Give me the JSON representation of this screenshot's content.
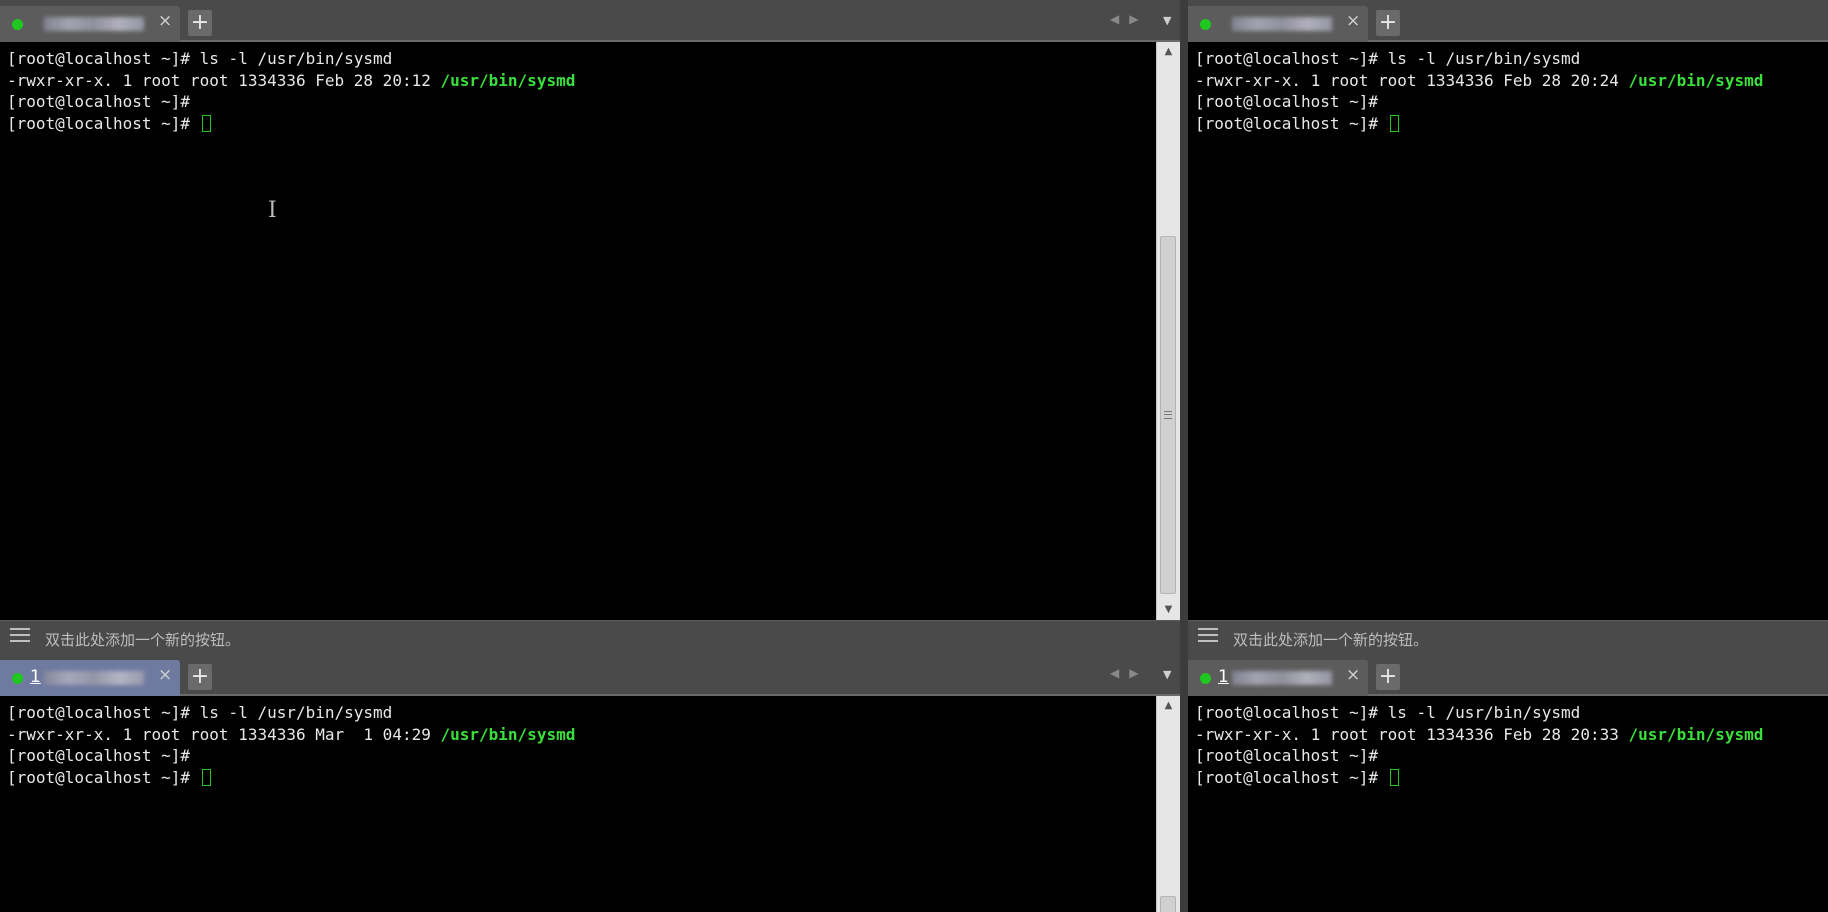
{
  "colors": {
    "terminal_bg": "#000000",
    "prompt_text": "#e8e8e8",
    "path_green": "#3ae03a",
    "status_dot": "#1ec81e",
    "active_tab": "#6e7aa0"
  },
  "quickbar_text": "双击此处添加一个新的按钮。",
  "icons": {
    "tab_close": "×",
    "add_tab": "+",
    "nav_prev": "◀",
    "nav_next": "▶",
    "tab_list": "▼",
    "scroll_up": "▲",
    "scroll_down": "▼",
    "quickbar_menu": "hamburger-icon"
  },
  "panes": [
    {
      "tab": {
        "number": "",
        "active": false
      },
      "lines": {
        "l1": "[root@localhost ~]# ls -l /usr/bin/sysmd",
        "l2_prefix": "-rwxr-xr-x. 1 root root 1334336 Feb 28 20:12 ",
        "l2_path": "/usr/bin/sysmd",
        "l3": "[root@localhost ~]#",
        "l4": "[root@localhost ~]# "
      }
    },
    {
      "tab": {
        "number": "",
        "active": false
      },
      "lines": {
        "l1": "[root@localhost ~]# ls -l /usr/bin/sysmd",
        "l2_prefix": "-rwxr-xr-x. 1 root root 1334336 Feb 28 20:24 ",
        "l2_path": "/usr/bin/sysmd",
        "l3": "[root@localhost ~]#",
        "l4": "[root@localhost ~]# "
      }
    },
    {
      "tab": {
        "number": "1",
        "active": true
      },
      "lines": {
        "l1": "[root@localhost ~]# ls -l /usr/bin/sysmd",
        "l2_prefix": "-rwxr-xr-x. 1 root root 1334336 Mar  1 04:29 ",
        "l2_path": "/usr/bin/sysmd",
        "l3": "[root@localhost ~]#",
        "l4": "[root@localhost ~]# "
      }
    },
    {
      "tab": {
        "number": "1",
        "active": false
      },
      "lines": {
        "l1": "[root@localhost ~]# ls -l /usr/bin/sysmd",
        "l2_prefix": "-rwxr-xr-x. 1 root root 1334336 Feb 28 20:33 ",
        "l2_path": "/usr/bin/sysmd",
        "l3": "[root@localhost ~]#",
        "l4": "[root@localhost ~]# "
      }
    }
  ]
}
